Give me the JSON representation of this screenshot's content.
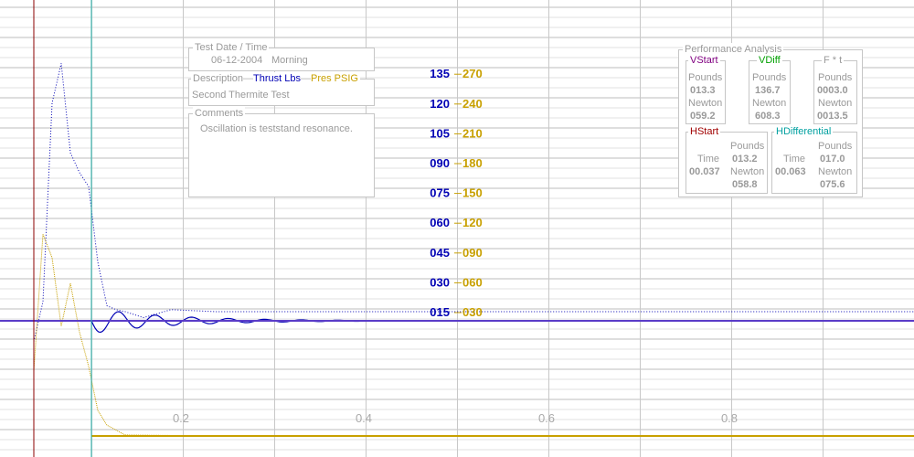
{
  "chart_data": {
    "type": "line",
    "x_ticks": [
      "0.2",
      "0.4",
      "0.6",
      "0.8"
    ],
    "thrust_ticks": [
      "015",
      "030",
      "045",
      "060",
      "075",
      "090",
      "105",
      "120",
      "135"
    ],
    "pressure_ticks": [
      "030",
      "060",
      "090",
      "120",
      "150",
      "180",
      "210",
      "240",
      "270"
    ],
    "x_range": [
      0.0,
      1.0
    ],
    "grid": true,
    "series": [
      {
        "name": "Thrust Lbs",
        "color": "#0000b4",
        "x": [
          0.0,
          0.01,
          0.02,
          0.03,
          0.04,
          0.05,
          0.06,
          0.07,
          0.08,
          0.09,
          0.1,
          0.12,
          0.15,
          0.2,
          0.3,
          0.5,
          0.7,
          1.0
        ],
        "y": [
          0,
          20,
          120,
          140,
          95,
          85,
          78,
          40,
          18,
          16,
          15,
          12,
          16,
          15,
          15,
          15,
          15,
          15
        ]
      },
      {
        "name": "Pres PSIG",
        "color": "#c8a000",
        "x": [
          0.0,
          0.01,
          0.02,
          0.03,
          0.04,
          0.05,
          0.06,
          0.07,
          0.08,
          0.1,
          0.2,
          0.5,
          1.0
        ],
        "y": [
          0,
          140,
          116,
          46,
          90,
          40,
          5,
          -40,
          -55,
          -65,
          -66,
          -66,
          -66
        ]
      }
    ]
  },
  "test_date": {
    "title": "Test Date / Time",
    "date": "06-12-2004",
    "time": "Morning"
  },
  "description": {
    "title": "Description",
    "thrust_label": "Thrust Lbs",
    "pressure_label": "Pres PSIG",
    "text": "Second Thermite Test"
  },
  "comments": {
    "title": "Comments",
    "text": "Oscillation is teststand resonance."
  },
  "performance": {
    "title": "Performance Analysis",
    "vstart": {
      "title": "VStart",
      "pounds_label": "Pounds",
      "pounds": "013.3",
      "newton_label": "Newton",
      "newton": "059.2"
    },
    "vdiff": {
      "title": "VDiff",
      "pounds_label": "Pounds",
      "pounds": "136.7",
      "newton_label": "Newton",
      "newton": "608.3"
    },
    "ft": {
      "title": "F * t",
      "pounds_label": "Pounds",
      "pounds": "0003.0",
      "newton_label": "Newton",
      "newton": "0013.5"
    },
    "hstart": {
      "title": "HStart",
      "time_label": "Time",
      "time": "00.037",
      "pounds_label": "Pounds",
      "pounds": "013.2",
      "newton_label": "Newton",
      "newton": "058.8"
    },
    "hdiff": {
      "title": "HDifferential",
      "time_label": "Time",
      "time": "00.063",
      "pounds_label": "Pounds",
      "pounds": "017.0",
      "newton_label": "Newton",
      "newton": "075.6"
    }
  },
  "colors": {
    "thrust": "#0000b4",
    "pressure": "#c8a000",
    "vstart": "#800080",
    "vdiff": "#00a000",
    "hstart": "#a00000",
    "hdiff": "#00a0a0",
    "start_cursor": "#8b0000",
    "end_cursor": "#20b2aa",
    "baseline": "#5a3cc8"
  }
}
